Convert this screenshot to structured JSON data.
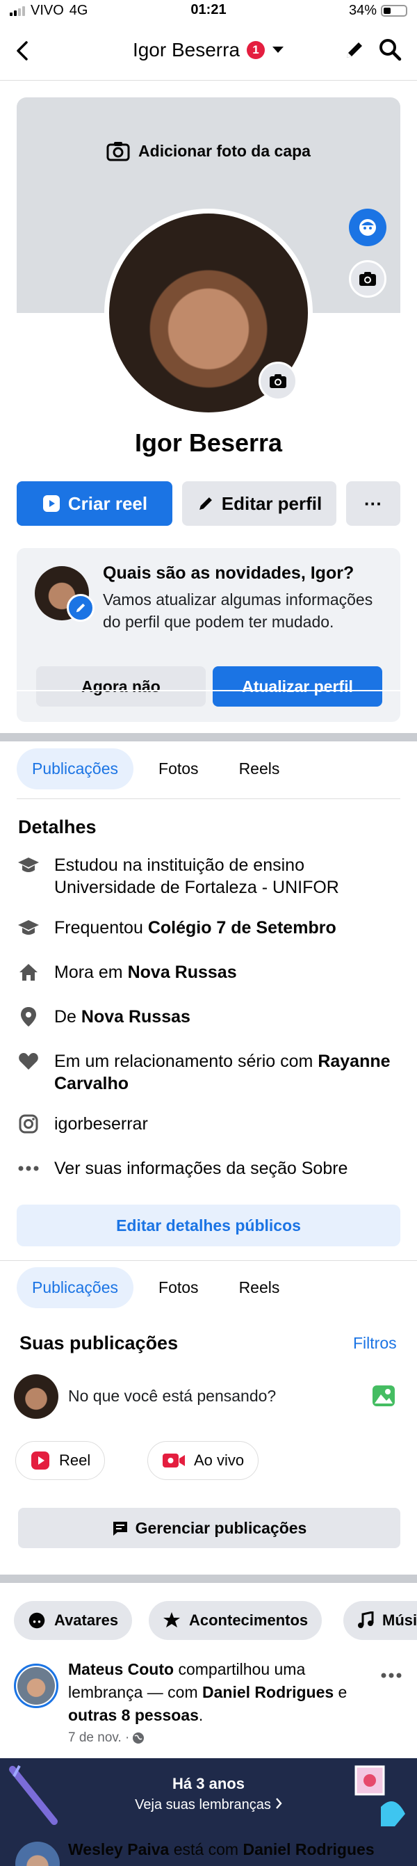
{
  "status": {
    "carrier": "VIVO",
    "network": "4G",
    "time": "01:21",
    "battery": "34%"
  },
  "header": {
    "title": "Igor Beserra",
    "badge": "1"
  },
  "cover": {
    "add_label": "Adicionar foto da capa"
  },
  "profile": {
    "name": "Igor Beserra"
  },
  "actions": {
    "create_reel": "Criar reel",
    "edit_profile": "Editar perfil",
    "more": "···"
  },
  "news": {
    "title": "Quais são as novidades, Igor?",
    "text": "Vamos atualizar algumas informações do perfil que podem ter mudado.",
    "not_now": "Agora não",
    "update": "Atualizar perfil"
  },
  "tabs": [
    "Publicações",
    "Fotos",
    "Reels"
  ],
  "details": {
    "title": "Detalhes",
    "rows": [
      {
        "icon": "graduation-cap-icon",
        "pre": "Estudou na instituição de ensino Universidade de Fortaleza - UNIFOR",
        "bold": ""
      },
      {
        "icon": "graduation-cap-icon",
        "pre": "Frequentou ",
        "bold": "Colégio 7 de Setembro"
      },
      {
        "icon": "home-icon",
        "pre": "Mora em ",
        "bold": "Nova Russas"
      },
      {
        "icon": "location-pin-icon",
        "pre": "De ",
        "bold": "Nova Russas"
      },
      {
        "icon": "heart-icon",
        "pre": "Em um relacionamento sério com ",
        "bold": "Rayanne Carvalho"
      },
      {
        "icon": "instagram-icon",
        "pre": "igorbeserrar",
        "bold": ""
      },
      {
        "icon": "more-dots-icon",
        "pre": "Ver suas informações da seção Sobre",
        "bold": ""
      }
    ],
    "edit_public": "Editar detalhes públicos"
  },
  "posts": {
    "title": "Suas publicações",
    "filters": "Filtros",
    "composer": "No que você está pensando?",
    "reel": "Reel",
    "live": "Ao vivo",
    "manage": "Gerenciar publicações"
  },
  "chips": [
    "Avatares",
    "Acontecimentos",
    "Músi"
  ],
  "feed": {
    "author": "Mateus Couto",
    "text1": " compartilhou uma lembrança — com ",
    "with": "Daniel Rodrigues",
    "text2": " e ",
    "others": "outras 8 pessoas",
    "end": ".",
    "date": "7 de nov. · ",
    "memory_title": "Há 3 anos",
    "memory_sub": "Veja suas lembranças",
    "next_author": "Wesley Paiva",
    "next_text": " está com ",
    "next_with": "Daniel Rodrigues"
  },
  "colors": {
    "accent": "#1b74e4",
    "badge": "#e41e3f"
  }
}
